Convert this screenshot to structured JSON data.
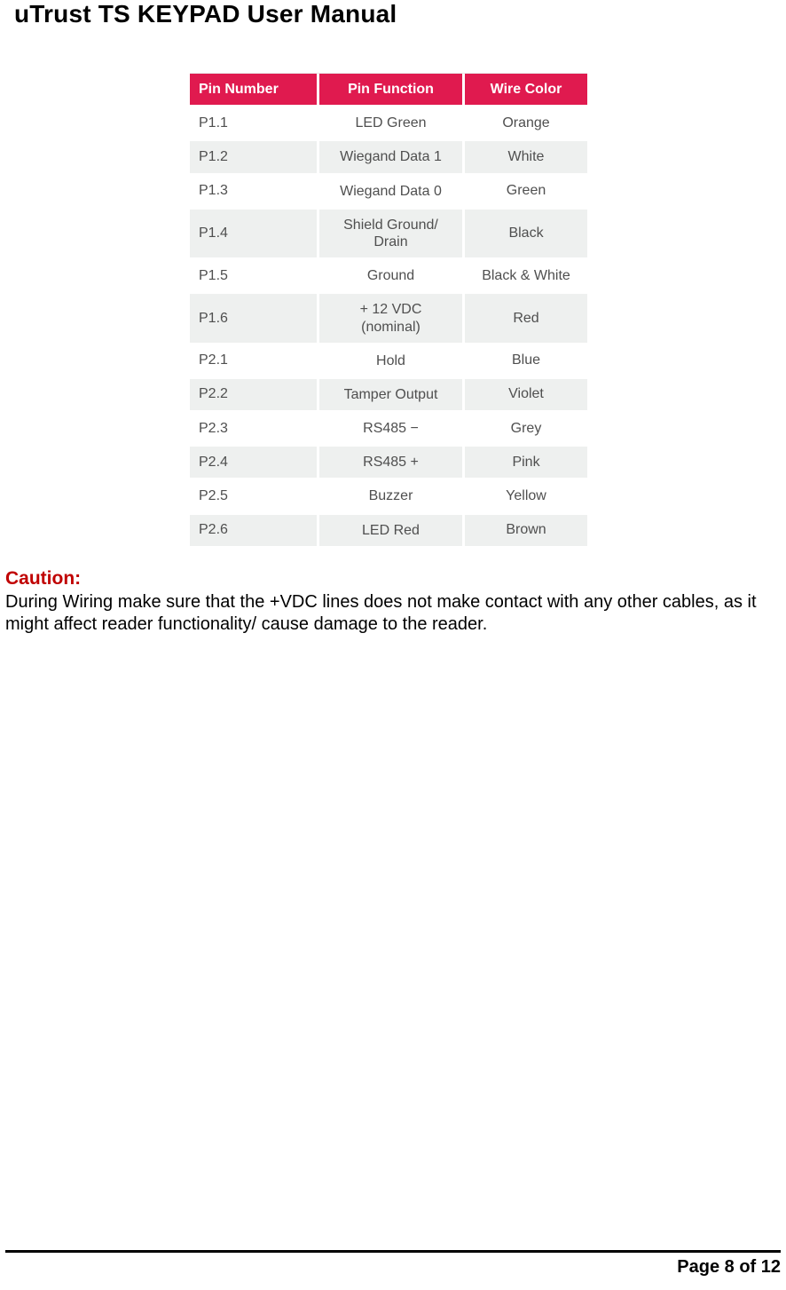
{
  "title": "uTrust TS KEYPAD User Manual",
  "table": {
    "headers": [
      "Pin Number",
      "Pin Function",
      "Wire Color"
    ],
    "rows": [
      {
        "pin": "P1.1",
        "func": "LED Green",
        "wire": "Orange"
      },
      {
        "pin": "P1.2",
        "func": "Wiegand Data 1",
        "wire": "White"
      },
      {
        "pin": "P1.3",
        "func": "Wiegand Data 0",
        "wire": "Green"
      },
      {
        "pin": "P1.4",
        "func": "Shield Ground/\nDrain",
        "wire": "Black"
      },
      {
        "pin": "P1.5",
        "func": "Ground",
        "wire": "Black & White"
      },
      {
        "pin": "P1.6",
        "func": "+ 12 VDC\n(nominal)",
        "wire": "Red"
      },
      {
        "pin": "P2.1",
        "func": "Hold",
        "wire": "Blue"
      },
      {
        "pin": "P2.2",
        "func": "Tamper Output",
        "wire": "Violet"
      },
      {
        "pin": "P2.3",
        "func": "RS485 −",
        "wire": "Grey"
      },
      {
        "pin": "P2.4",
        "func": "RS485 +",
        "wire": "Pink"
      },
      {
        "pin": "P2.5",
        "func": "Buzzer",
        "wire": "Yellow"
      },
      {
        "pin": "P2.6",
        "func": "LED Red",
        "wire": "Brown"
      }
    ]
  },
  "caution": {
    "label": "Caution:",
    "text": "During Wiring make sure that the +VDC lines does not make contact with any other cables, as it might affect reader functionality/ cause damage to the reader."
  },
  "footer": "Page 8 of 12"
}
